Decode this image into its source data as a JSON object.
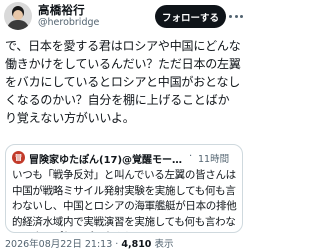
{
  "author": {
    "name": "高橋裕行",
    "handle": "@herobridge"
  },
  "follow_label": "フォローする",
  "tweet_text": "で、日本を愛する君はロシアや中国にどんな働きかけをしているんだい？ただ日本の左翼をバカにしているとロシアと中国がおとなしくなるのかい？自分を棚に上げることばかり覚えない方がいいよ。",
  "quote": {
    "avatar_glyph": "冒",
    "name": "冒険家ゆたぽん(17)@覚醒モー…",
    "separator": "·",
    "time": "11時間",
    "text": "いつも「戦争反対」と叫んでいる左翼の皆さんは中国が戦略ミサイル発射実験を実施しても何も言わないし、中国とロシアの海軍艦艇が日本の排他的経済水域内で実戦演習を実施しても何も言わない。やっぱりスパイなんじ…"
  },
  "meta": {
    "timestamp": "2026年08月22日 21:13",
    "separator": "·",
    "views_count": "4,810",
    "views_label": "表示"
  },
  "colors": {
    "text": "#0f1419",
    "secondary": "#536471",
    "border": "#cfd9de",
    "follow_bg": "#0f1419"
  }
}
